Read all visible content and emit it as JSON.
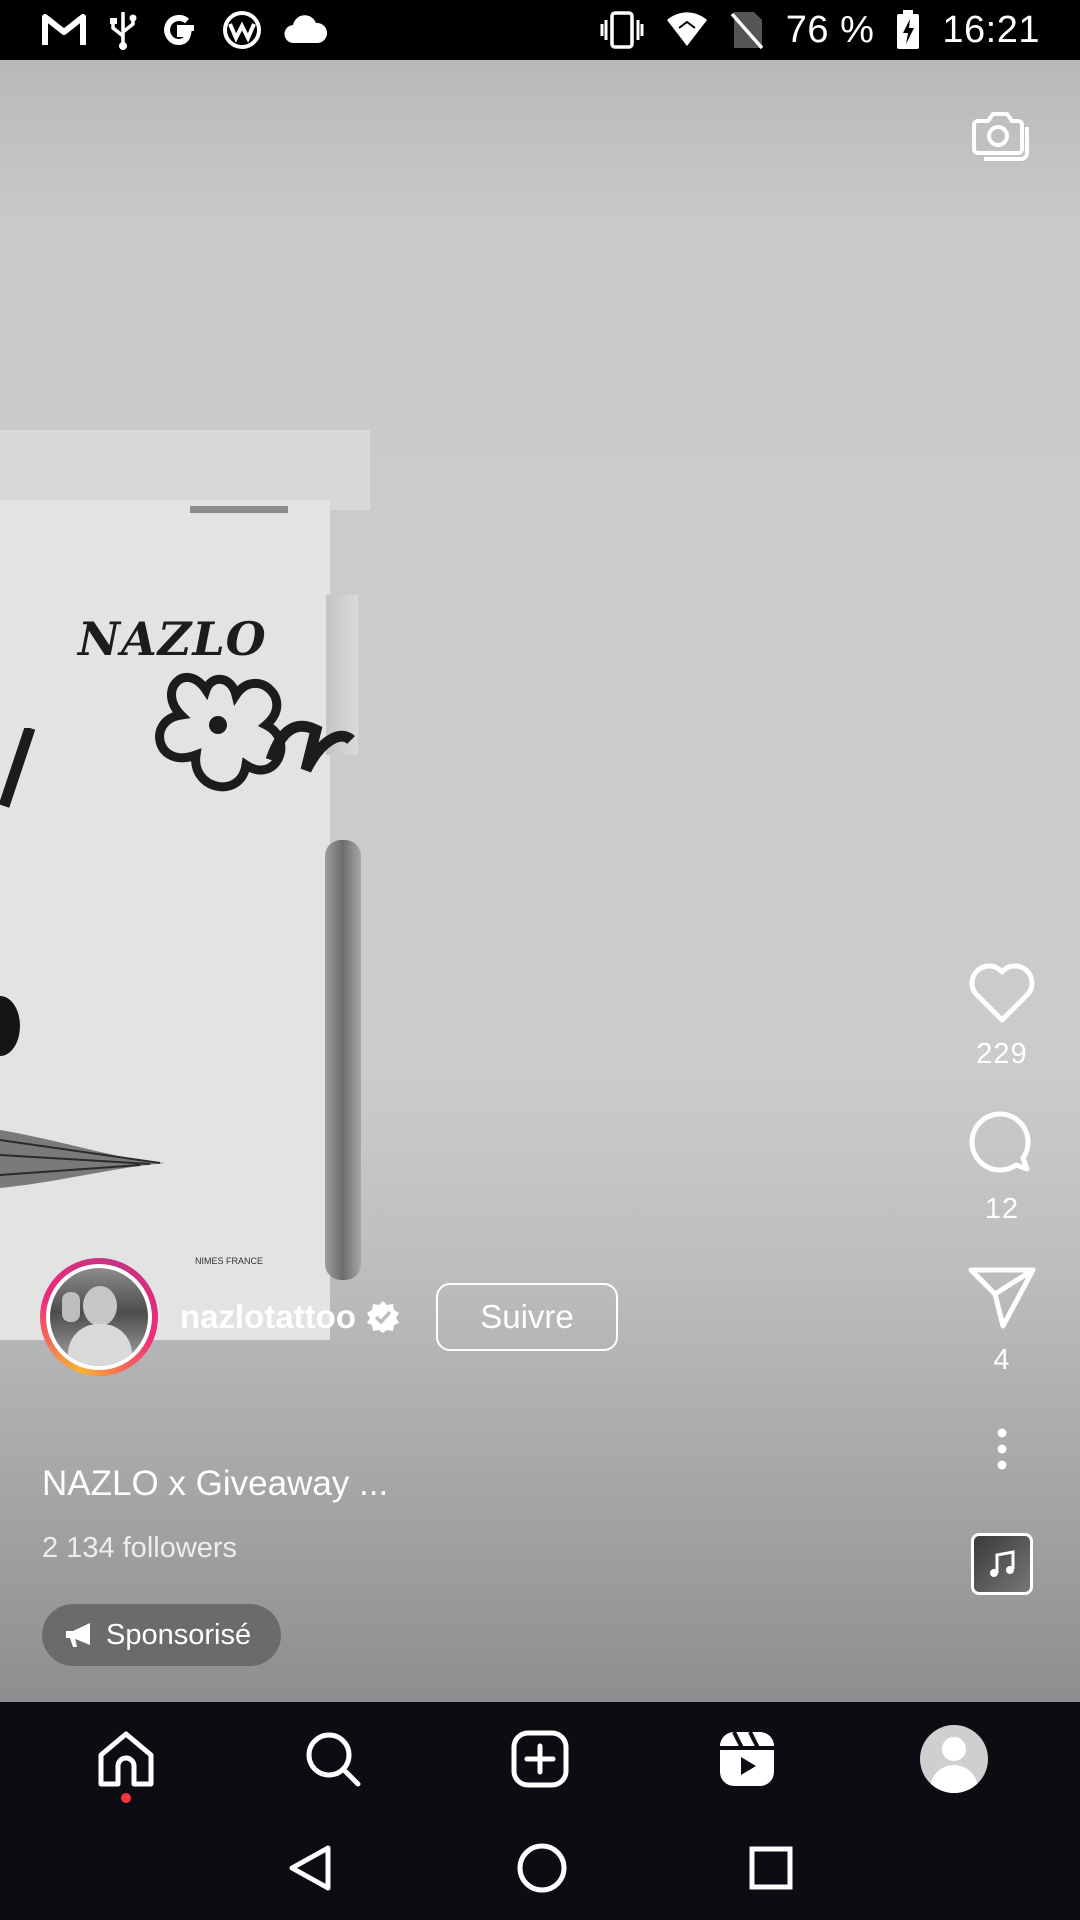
{
  "status_bar": {
    "battery": "76 %",
    "time": "16:21",
    "left_icons": [
      "gmail-icon",
      "usb-icon",
      "google-icon",
      "app-icon",
      "cloud-icon"
    ],
    "right_icons": [
      "vibrate-icon",
      "wifi-icon",
      "no-sim-icon",
      "battery-charging-icon"
    ]
  },
  "reel": {
    "poster_logo": "NAZLO",
    "poster_small_text": "NIMES FRANCE"
  },
  "actions": {
    "likes": "229",
    "comments": "12",
    "shares": "4"
  },
  "author": {
    "username": "nazlotattoo",
    "verified": true,
    "follow_label": "Suivre"
  },
  "caption": "NAZLO x Giveaway ...",
  "followers": "2 134 followers",
  "sponsored_label": "Sponsorisé",
  "bottom_nav": [
    "home-icon",
    "search-icon",
    "create-icon",
    "reels-icon",
    "profile-avatar"
  ],
  "system_nav": [
    "back-icon",
    "home-circle-icon",
    "recents-icon"
  ],
  "colors": {
    "status_bar": "#000000",
    "nav_background": "#0c0c12",
    "notification_dot": "#ff3040"
  }
}
